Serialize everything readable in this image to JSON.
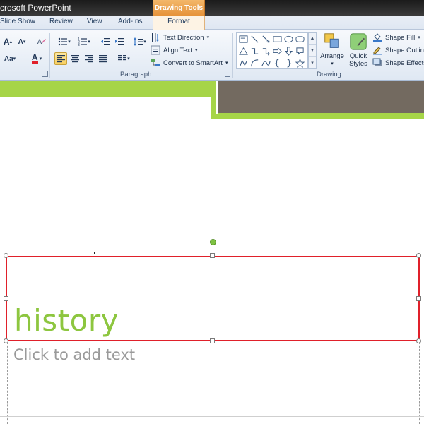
{
  "app": {
    "title": "crosoft PowerPoint"
  },
  "contextual": {
    "header": "Drawing Tools"
  },
  "tabs": {
    "slide_show": "Slide Show",
    "review": "Review",
    "view": "View",
    "add_ins": "Add-Ins",
    "format": "Format"
  },
  "ribbon": {
    "paragraph_label": "Paragraph",
    "drawing_label": "Drawing",
    "text_direction": "Text Direction",
    "align_text": "Align Text",
    "convert_smartart": "Convert to SmartArt",
    "arrange": "Arrange",
    "quick_styles_1": "Quick",
    "quick_styles_2": "Styles",
    "shape_fill": "Shape Fill",
    "shape_outline": "Shape Outlin",
    "shape_effects": "Shape Effects",
    "font_grow": "A",
    "font_shrink": "A",
    "change_case": "Aa",
    "font_color": "A"
  },
  "slide": {
    "title_text": "history",
    "content_placeholder": "Click to add text"
  },
  "colors": {
    "accent_green": "#8dc63f",
    "band_green": "#a6d548",
    "dark_box": "#736a60",
    "selection_red": "#e0202a"
  }
}
